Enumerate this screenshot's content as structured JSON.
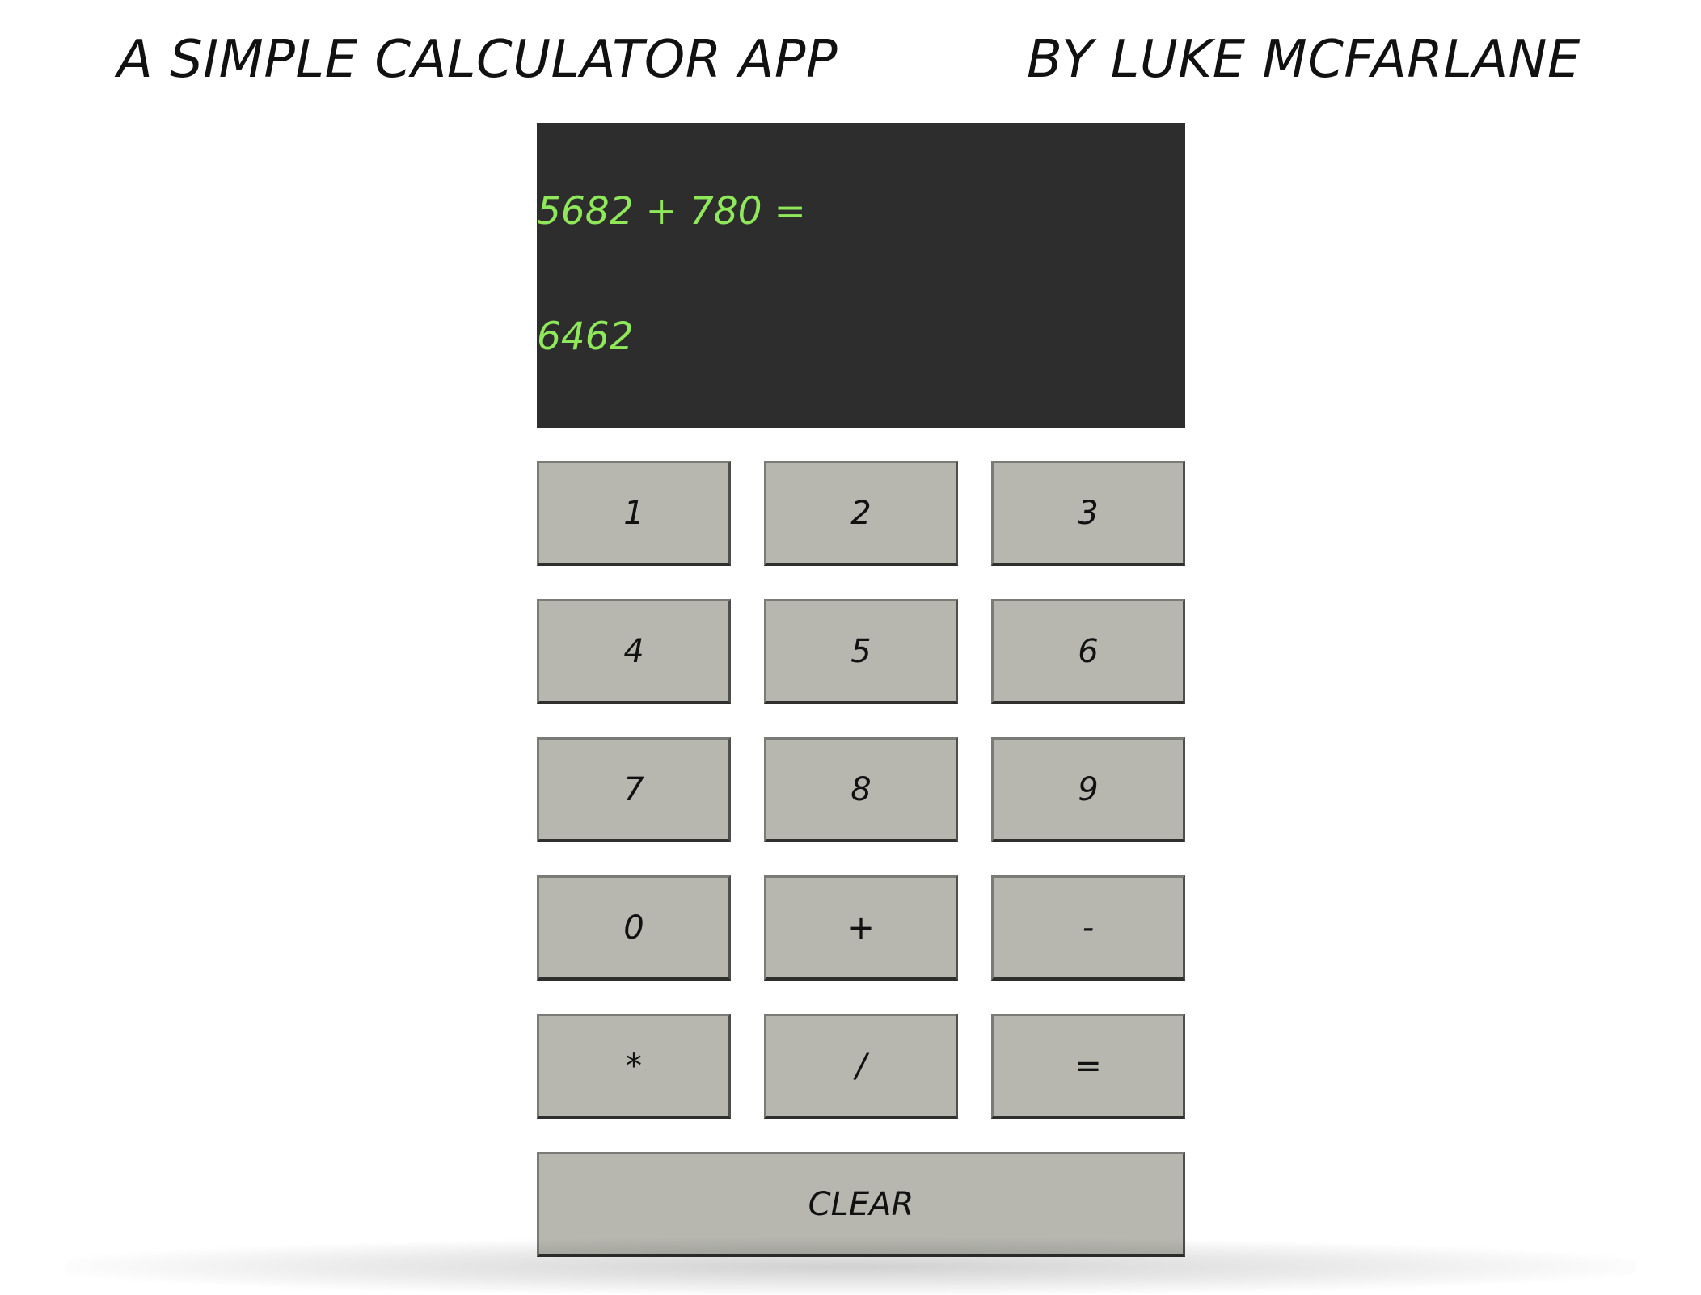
{
  "header": {
    "title": "A SIMPLE CALCULATOR APP",
    "author": "BY LUKE MCFARLANE"
  },
  "display": {
    "expression": "5682 + 780 =",
    "result": "6462"
  },
  "keys": {
    "k1": "1",
    "k2": "2",
    "k3": "3",
    "k4": "4",
    "k5": "5",
    "k6": "6",
    "k7": "7",
    "k8": "8",
    "k9": "9",
    "k0": "0",
    "plus": "+",
    "minus": "-",
    "multiply": "*",
    "divide": "/",
    "equals": "=",
    "clear": "CLEAR"
  },
  "colors": {
    "display_bg": "#2d2d2d",
    "display_text": "#8fe85a",
    "key_bg": "#b7b7b0"
  }
}
